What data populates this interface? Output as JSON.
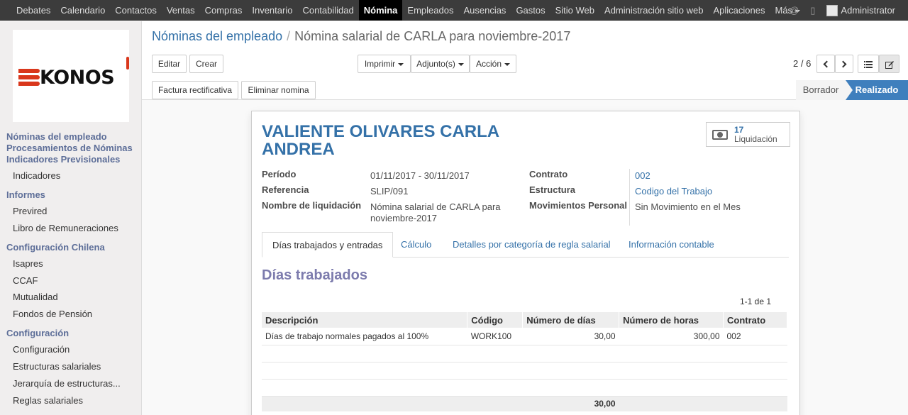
{
  "topnav": {
    "items": [
      "Debates",
      "Calendario",
      "Contactos",
      "Ventas",
      "Compras",
      "Inventario",
      "Contabilidad",
      "Nómina",
      "Empleados",
      "Ausencias",
      "Gastos",
      "Sitio Web",
      "Administración sitio web",
      "Aplicaciones",
      "Más"
    ],
    "active": "Nómina",
    "user": "Administrator"
  },
  "logo": {
    "text": "KONOS"
  },
  "sidebar": {
    "links": [
      "Nóminas del empleado",
      "Procesamientos de Nóminas",
      "Indicadores Previsionales"
    ],
    "indicadores": "Indicadores",
    "informes": "Informes",
    "informes_items": [
      "Previred",
      "Libro de Remuneraciones"
    ],
    "config_chilena": "Configuración Chilena",
    "config_chilena_items": [
      "Isapres",
      "CCAF",
      "Mutualidad",
      "Fondos de Pensión"
    ],
    "configuracion": "Configuración",
    "configuracion_items": [
      "Configuración",
      "Estructuras salariales",
      "Jerarquía de estructuras...",
      "Reglas salariales"
    ]
  },
  "breadcrumb": {
    "parent": "Nóminas del empleado",
    "separator": "/",
    "current": "Nómina salarial de CARLA para noviembre-2017"
  },
  "buttons": {
    "edit": "Editar",
    "create": "Crear",
    "print": "Imprimir",
    "attachments": "Adjunto(s)",
    "action": "Acción",
    "refund": "Factura rectificativa",
    "delete": "Eliminar nomina"
  },
  "pager": {
    "value": "2 / 6"
  },
  "statusbar": {
    "draft": "Borrador",
    "done": "Realizado"
  },
  "form": {
    "employee_name": "VALIENTE OLIVARES CARLA ANDREA",
    "smart_button": {
      "count": "17",
      "label": "Liquidación"
    },
    "periodo_label": "Período",
    "periodo_value": "01/11/2017 - 30/11/2017",
    "referencia_label": "Referencia",
    "referencia_value": "SLIP/091",
    "nombre_label": "Nombre de liquidación",
    "nombre_value": "Nómina salarial de CARLA para noviembre-2017",
    "contrato_label": "Contrato",
    "contrato_value": "002",
    "estructura_label": "Estructura",
    "estructura_value": "Codigo del Trabajo",
    "movimientos_label": "Movimientos Personal",
    "movimientos_value": "Sin Movimiento en el Mes"
  },
  "tabs": [
    "Días trabajados y entradas",
    "Cálculo",
    "Detalles por categoría de regla salarial",
    "Información contable"
  ],
  "section": {
    "title": "Días trabajados",
    "pager": "1-1 de 1",
    "columns": [
      "Descripción",
      "Código",
      "Número de días",
      "Número de horas",
      "Contrato"
    ],
    "rows": [
      {
        "descripcion": "Días de trabajo normales pagados al 100%",
        "codigo": "WORK100",
        "dias": "30,00",
        "horas": "300,00",
        "contrato": "002"
      }
    ],
    "total_dias": "30,00"
  }
}
